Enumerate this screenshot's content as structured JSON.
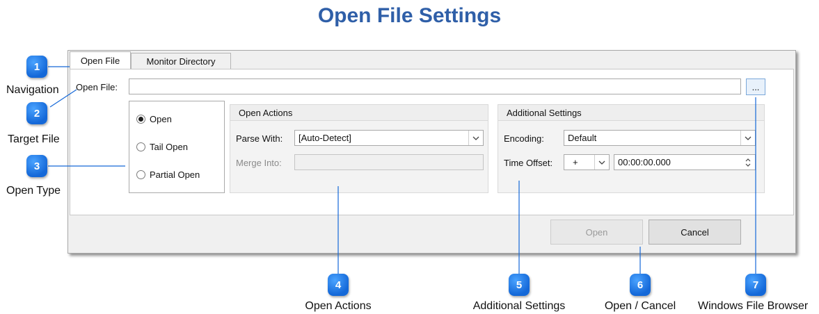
{
  "page_title": "Open File Settings",
  "accent_color": "#2f5fa8",
  "badge_color": "#1468d8",
  "tabs": [
    {
      "label": "Open File",
      "active": true
    },
    {
      "label": "Monitor Directory",
      "active": false
    }
  ],
  "file_row": {
    "label": "Open File:",
    "value": "",
    "browse_label": "..."
  },
  "open_type": {
    "options": [
      {
        "label": "Open",
        "selected": true
      },
      {
        "label": "Tail Open",
        "selected": false
      },
      {
        "label": "Partial Open",
        "selected": false
      }
    ]
  },
  "open_actions": {
    "header": "Open Actions",
    "parse_label": "Parse With:",
    "parse_value": "[Auto-Detect]",
    "merge_label": "Merge Into:",
    "merge_value": ""
  },
  "additional_settings": {
    "header": "Additional Settings",
    "encoding_label": "Encoding:",
    "encoding_value": "Default",
    "offset_label": "Time Offset:",
    "offset_sign": "+",
    "offset_value": "00:00:00.000"
  },
  "buttons": {
    "open_label": "Open",
    "cancel_label": "Cancel"
  },
  "callouts": [
    {
      "number": "1",
      "label": "Navigation"
    },
    {
      "number": "2",
      "label": "Target File"
    },
    {
      "number": "3",
      "label": "Open Type"
    },
    {
      "number": "4",
      "label": "Open Actions"
    },
    {
      "number": "5",
      "label": "Additional Settings"
    },
    {
      "number": "6",
      "label": "Open / Cancel"
    },
    {
      "number": "7",
      "label": "Windows File Browser"
    }
  ]
}
